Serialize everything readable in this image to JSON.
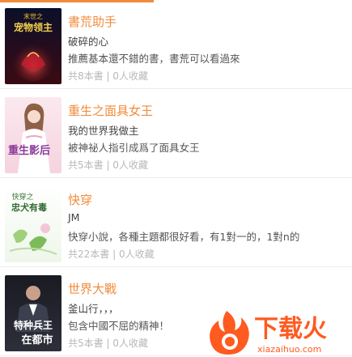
{
  "items": [
    {
      "title": "書荒助手",
      "author": "破碎的心",
      "desc": "推薦基本還不錯的書，書荒可以看過來",
      "stats": "共8本書 | 0人收藏",
      "cover": {
        "text1": "末世之",
        "text2": "宠物领主",
        "colors": {
          "bg_top": "#0b0f2a",
          "bg_bottom": "#3a0b12",
          "accent": "#e8c23a",
          "glow": "#d42a3a"
        }
      }
    },
    {
      "title": "重生之面具女王",
      "author": "我的世界我做主",
      "desc": "被神祕人指引成爲了面具女王",
      "stats": "共5本書 | 0人收藏",
      "cover": {
        "text1": "重生影后",
        "colors": {
          "bg_top": "#fbe9ee",
          "bg_bottom": "#f5d3df",
          "accent": "#8a3a9a",
          "glow": "#e9a7c0"
        }
      }
    },
    {
      "title": "快穿",
      "author": "JM",
      "desc": "快穿小說，各種主題都很好看，有1對一的，1對n的",
      "stats": "共22本書 | 0人收藏",
      "cover": {
        "text1": "快穿之",
        "text2": "忠犬有毒",
        "colors": {
          "bg_top": "#ffffff",
          "bg_bottom": "#eef6ea",
          "accent": "#3a7a3a",
          "glow": "#d9eed3"
        }
      }
    },
    {
      "title": "世界大戰",
      "author": "釜山行，，，",
      "desc": "包含中國不屈的精神！",
      "stats": "共5本書 | 0人收藏",
      "cover": {
        "text1": "特种兵王",
        "text2": "在都市",
        "colors": {
          "bg_top": "#1a1a22",
          "bg_bottom": "#2d2f3a",
          "accent": "#ffffff",
          "glow": "#c9a34a"
        }
      }
    }
  ],
  "watermark": {
    "brand": "下载火",
    "url": "xiazaihuo.com",
    "colors": {
      "brand": "#ff5a1f"
    }
  },
  "colors": {
    "title": "#f08c3c",
    "divider": "#ececec"
  }
}
